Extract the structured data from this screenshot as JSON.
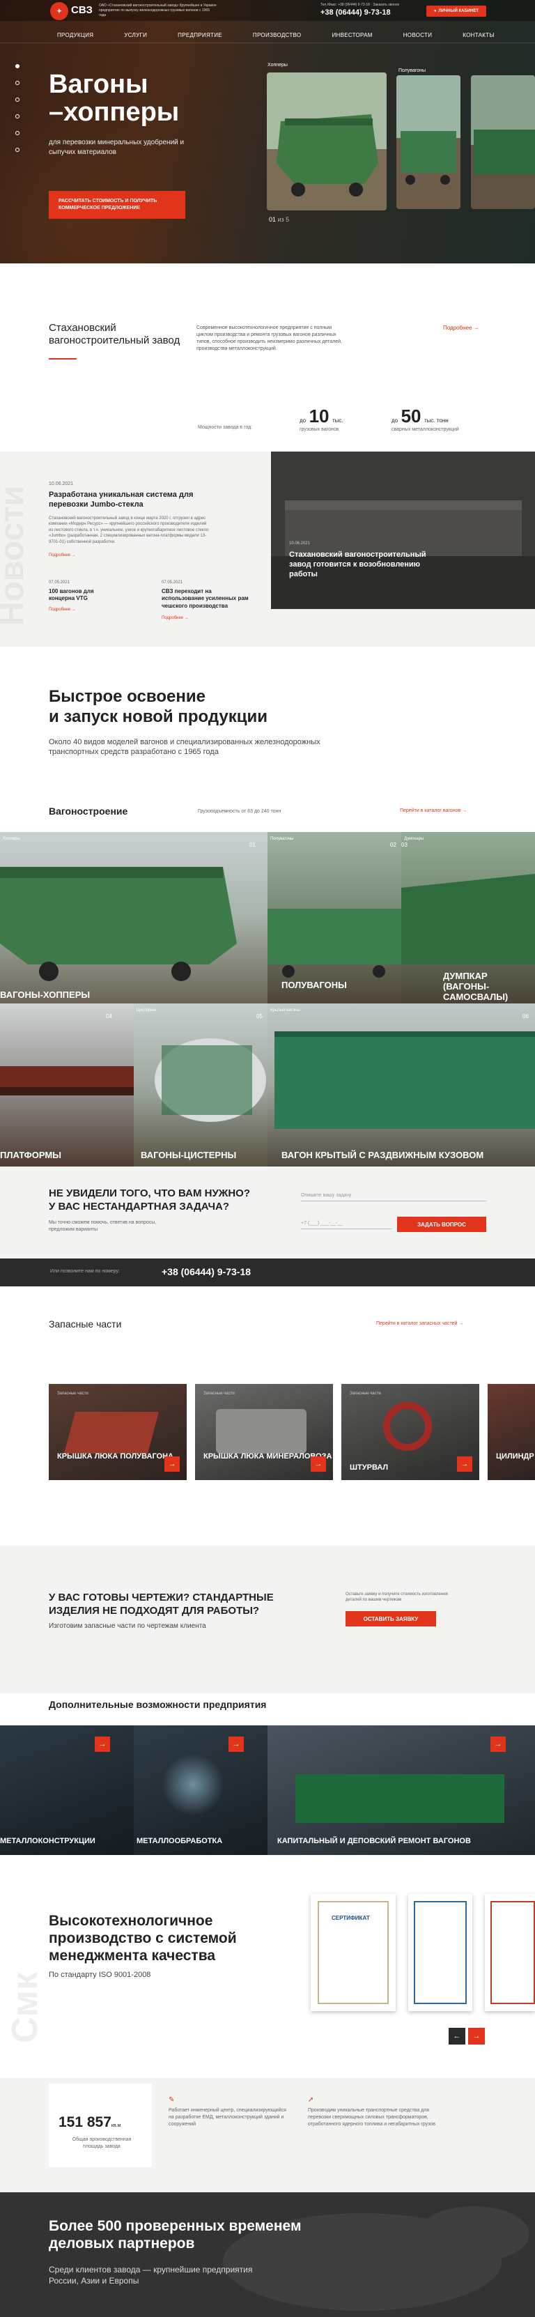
{
  "header": {
    "logo_text": "СВЗ",
    "company_desc": "ОАО «Стахановский вагоностроительный завод» Крупнейшее в Украине предприятие по выпуску железнодорожных грузовых вагонов с 1965 года",
    "phone_small": "Тел./Факс: +38 (06444) 9-73-18 · Заказать звонок",
    "phone": "+38 (06444) 9-73-18",
    "cabinet_button": "Личный кабинет",
    "nav": [
      "Продукция",
      "Услуги",
      "Предприятие",
      "Производство",
      "Инвесторам",
      "Новости",
      "Контакты"
    ]
  },
  "hero": {
    "title_line1": "Вагоны",
    "title_line2": "–хопперы",
    "subtitle": "для перевозки минеральных удобрений и сыпучих материалов",
    "cta": "Рассчитать стоимость и получить коммерческое предложение",
    "slide_labels": [
      "Хопперы",
      "Полувагоны"
    ],
    "slide_counter": "01",
    "slide_counter_total": "из 5"
  },
  "about": {
    "title": "Стахановский вагоностроительный завод",
    "text": "Современное высокотехнологичное предприятие с полным циклом производства и ремонта грузовых вагонов различных типов, способное производить неизмеримо различных деталей, производства металлоконструкций.",
    "more": "Подробнее →",
    "capacity_label": "Мощности завода в год:",
    "stat1_prefix": "до",
    "stat1_value": "10",
    "stat1_unit": "тыс.",
    "stat1_label": "грузовых вагонов",
    "stat2_prefix": "до",
    "stat2_value": "50",
    "stat2_unit": "тыс. тонн",
    "stat2_label": "сварных металлоконструкций"
  },
  "news": {
    "bg_word": "Новости",
    "main_date": "10.06.2021",
    "main_title": "Разработана уникальная система для перевозки Jumbo-стекла",
    "main_text": "Стахановский вагоностроительный завод в конце марта 2020 г. отгрузил в адрес компании «Модерн Ресурс» — крупнейшего российского производителя изделий из листового стекла, в т.ч. уникальное, узкое и крупногабаритное листовое стекло «Jumbo» (разработанная, 2 специализированных вагона-платформы модели 13-9701-01) собственной разработки.",
    "more": "Подробнее →",
    "small1_date": "07.05.2021",
    "small1_title": "100 вагонов для концерна VTG",
    "small1_more": "Подробнее →",
    "small2_date": "07.05.2021",
    "small2_title": "СВЗ переходит на использование усиленных рам чешского производства",
    "small2_more": "Подробнее →",
    "featured_date": "10.06.2021",
    "featured_title": "Стахановский вагоностроительный завод готовится к возобновлению работы"
  },
  "fast": {
    "title_line1": "Быстрое освоение",
    "title_line2": "и запуск новой продукции",
    "text": "Около 40 видов моделей вагонов и специализированных железнодорожных транспортных средств разработано с 1965 года"
  },
  "wagons": {
    "title": "Вагоностроение",
    "capacity": "Грузоподъемность от 63 до 240 тонн",
    "catalog_link": "Перейти в каталог вагонов →",
    "tiles": [
      {
        "label": "Вагоны-хопперы",
        "num": "01"
      },
      {
        "label": "Полувагоны",
        "num": "02"
      },
      {
        "label": "Думпкар (вагоны-самосвалы)",
        "num": "03"
      },
      {
        "label": "Платформы",
        "num": "04"
      },
      {
        "label": "Вагоны-цистерны",
        "num": "05"
      },
      {
        "label": "Вагон крытый с раздвижным кузовом",
        "num": "06"
      }
    ],
    "tile_tags": [
      "Хопперы",
      "Полувагоны",
      "Думпкары",
      "Платформы",
      "Цистерны",
      "Крытые вагоны"
    ]
  },
  "nonstandard": {
    "title_line1": "Не увидели того, что вам нужно?",
    "title_line2": "У вас нестандартная задача?",
    "text": "Мы точно сможем помочь, ответив на вопросы, предложим варианты",
    "field1_placeholder": "Опишите вашу задачу",
    "field2_placeholder": "+7 (___) ___-__-__",
    "button": "Задать вопрос"
  },
  "callbar": {
    "label": "Или позвоните нам по номеру:",
    "phone": "+38 (06444) 9-73-18"
  },
  "parts": {
    "title": "Запасные части",
    "catalog_link": "Перейти в каталог запасных частей →",
    "tag": "Запасные части",
    "cards": [
      "Крышка люка полувагона",
      "Крышка люка минераловоза",
      "Штурвал",
      "Цилиндр разгрузочный"
    ],
    "arrow": "→"
  },
  "drawings": {
    "title_line1": "У вас готовы чертежи? Стандартные",
    "title_line2": "изделия не подходят для работы?",
    "subtitle": "Изготовим запасные части по чертежам клиента",
    "text": "Оставьте заявку и получите стоимость изготовления деталей по вашим чертежам",
    "button": "Оставить заявку"
  },
  "extra": {
    "title": "Дополнительные возможности предприятия",
    "tiles": [
      "Металлоконструкции",
      "Металлообработка",
      "Капитальный и деповский ремонт вагонов"
    ]
  },
  "quality": {
    "bg_word": "Смк",
    "title_line1": "Высокотехнологичное",
    "title_line2": "производство с системой",
    "title_line3": "менеджмента качества",
    "subtitle": "По стандарту ISO 9001-2008",
    "cert_title": "Сертификат",
    "prev": "←",
    "next": "→"
  },
  "area": {
    "value": "151 857",
    "unit": "кв.м",
    "label": "Общая производственная площадь завода",
    "text1": "Работает инженерный центр, специализирующийся на разработке ЕМД, металлоконструкций зданий и сооружений",
    "text2": "Производим уникальные транспортные средства для перевозки сверхмощных силовых трансформаторов, отработанного ядерного топлива и негабаритных грузов"
  },
  "partners": {
    "title_line1": "Более 500 проверенных временем",
    "title_line2": "деловых партнеров",
    "text_line1": "Среди клиентов завода — крупнейшие предприятия",
    "text_line2": "России, Азии и Европы"
  },
  "colors": {
    "accent": "#e2331b",
    "dark": "#2b2b2b",
    "light": "#f3f3f1"
  }
}
